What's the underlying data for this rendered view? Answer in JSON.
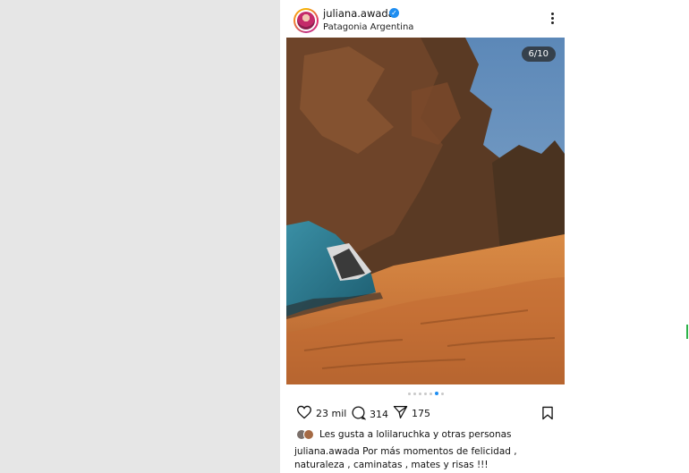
{
  "post": {
    "username": "juliana.awada",
    "location": "Patagonia Argentina",
    "slide_counter": "6/10",
    "carousel": {
      "total": 10,
      "current": 6
    },
    "likes": "23 mil",
    "comments": "314",
    "shares": "175",
    "liked_by": "Les gusta a lolilaruchka y otras personas",
    "caption_lines": [
      "juliana.awada Por más momentos de felicidad ,",
      "naturaleza , caminatas , mates y risas !!!"
    ]
  },
  "colors": {
    "accent": "#1f8ef1",
    "left_bg": "#e6e6e6"
  },
  "icons": [
    "verified-icon",
    "more-icon",
    "heart-icon",
    "comment-icon",
    "share-icon",
    "bookmark-icon"
  ]
}
